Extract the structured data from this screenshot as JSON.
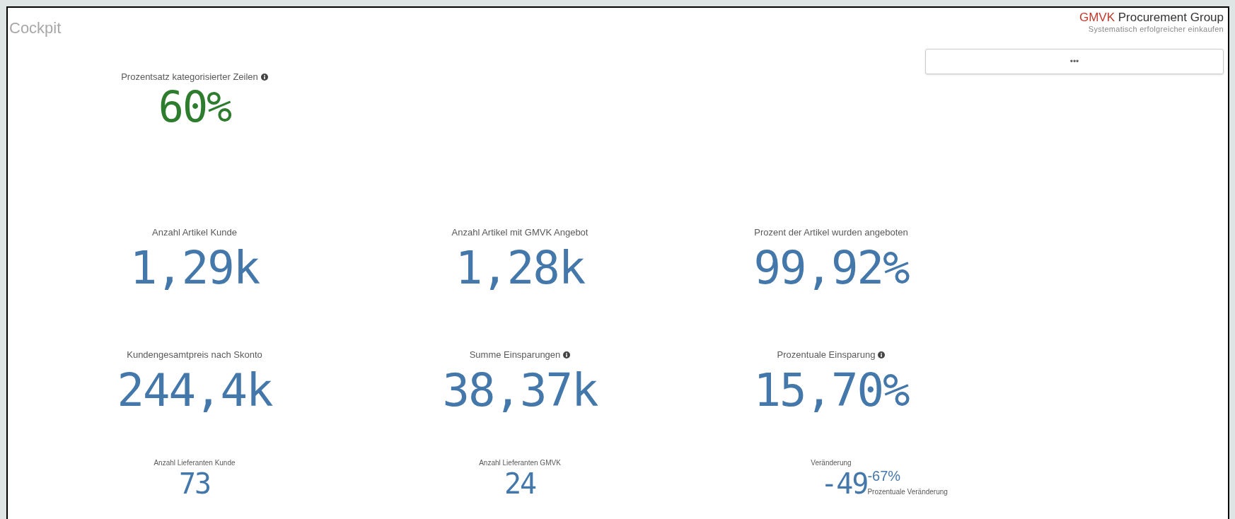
{
  "title": "Cockpit",
  "logo": {
    "brand": "GMVK",
    "name": "Procurement Group",
    "tagline": "Systematisch erfolgreicher einkaufen"
  },
  "menu_button": {
    "label": "•••"
  },
  "kpi_rows": [
    [
      {
        "kind": "value",
        "label": "Prozentsatz kategorisierter Zeilen",
        "info": true,
        "value": "60%",
        "color": "#2e7d2e"
      }
    ],
    [
      {
        "kind": "value",
        "label": "Anzahl Artikel Kunde",
        "info": false,
        "value": "1,29k",
        "color": "#4477aa"
      },
      {
        "kind": "value",
        "label": "Anzahl Artikel mit GMVK Angebot",
        "info": false,
        "value": "1,28k",
        "color": "#4477aa"
      },
      {
        "kind": "value",
        "label": "Prozent der Artikel wurden angeboten",
        "info": false,
        "value": "99,92%",
        "color": "#4477aa"
      }
    ],
    [
      {
        "kind": "value",
        "label": "Kundengesamtpreis nach Skonto",
        "info": false,
        "value": "244,4k",
        "color": "#4477aa"
      },
      {
        "kind": "value",
        "label": "Summe Einsparungen",
        "info": true,
        "value": "38,37k",
        "color": "#4477aa"
      },
      {
        "kind": "value",
        "label": "Prozentuale Einsparung",
        "info": true,
        "value": "15,70%",
        "color": "#4477aa"
      }
    ],
    [
      {
        "kind": "value",
        "label": "Anzahl Lieferanten Kunde",
        "info": false,
        "value": "73",
        "color": "#4477aa"
      },
      {
        "kind": "value",
        "label": "Anzahl Lieferanten GMVK",
        "info": false,
        "value": "24",
        "color": "#4477aa"
      },
      {
        "kind": "change",
        "label": "Veränderung",
        "info": false,
        "value": "-49",
        "color": "#4477aa",
        "secondary_value": "-67%",
        "secondary_label": "Prozentuale Veränderung"
      }
    ]
  ]
}
